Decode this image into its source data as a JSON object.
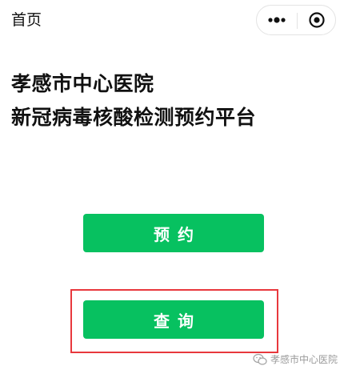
{
  "nav": {
    "title": "首页"
  },
  "capsule": {
    "more_icon": "more-dots-icon",
    "close_icon": "target-close-icon"
  },
  "headline": {
    "line1": "孝感市中心医院",
    "line2": "新冠病毒核酸检测预约平台"
  },
  "actions": {
    "reserve_label": "预约",
    "query_label": "查询"
  },
  "watermark": {
    "icon": "wechat-icon",
    "text": "孝感市中心医院"
  },
  "colors": {
    "primary": "#07c160",
    "highlight": "#e8383d",
    "text": "#111111"
  }
}
